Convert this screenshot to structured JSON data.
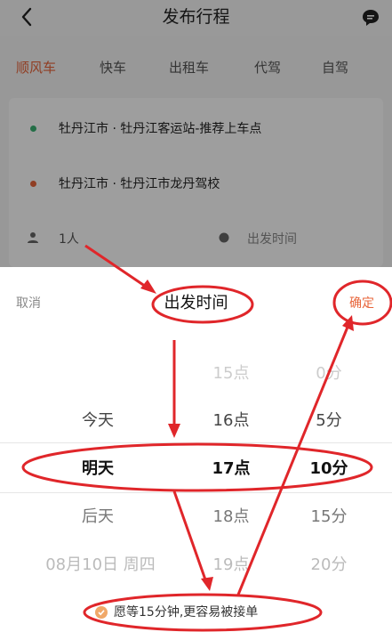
{
  "header": {
    "title": "发布行程"
  },
  "tabs": [
    {
      "label": "顺风车",
      "active": true
    },
    {
      "label": "快车"
    },
    {
      "label": "出租车"
    },
    {
      "label": "代驾"
    },
    {
      "label": "自驾"
    }
  ],
  "trip": {
    "origin": "牡丹江市 · 牡丹江客运站-推荐上车点",
    "destination": "牡丹江市 · 牡丹江市龙丹驾校",
    "passengers": "1人",
    "depart_placeholder": "出发时间"
  },
  "sheet": {
    "cancel_label": "取消",
    "title": "出发时间",
    "confirm_label": "确定",
    "days": [
      "今天",
      "明天",
      "后天",
      "08月10日 周四"
    ],
    "hours": [
      "15点",
      "16点",
      "17点",
      "18点",
      "19点"
    ],
    "minutes": [
      "0分",
      "5分",
      "10分",
      "15分",
      "20分"
    ],
    "selected": {
      "day": "明天",
      "hour": "17点",
      "minute": "10分"
    },
    "wait_note": "愿等15分钟,更容易被接单"
  },
  "colors": {
    "accent": "#e8653a",
    "annotation": "#e0262a"
  }
}
